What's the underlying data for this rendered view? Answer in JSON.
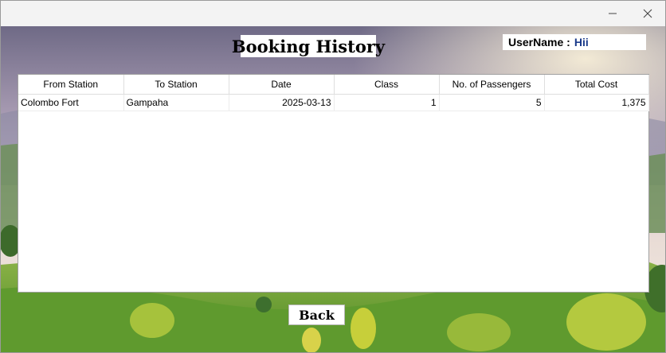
{
  "window": {
    "minimize_icon": "minimize-icon",
    "close_icon": "close-icon"
  },
  "page": {
    "title": "Booking History"
  },
  "user": {
    "label": "UserName :",
    "value": "Hii"
  },
  "table": {
    "columns": [
      "From Station",
      "To Station",
      "Date",
      "Class",
      "No. of Passengers",
      "Total Cost"
    ],
    "rows": [
      [
        "Colombo Fort",
        "Gampaha",
        "2025-03-13",
        "1",
        "5",
        "1,375"
      ]
    ]
  },
  "actions": {
    "back_label": "Back"
  }
}
